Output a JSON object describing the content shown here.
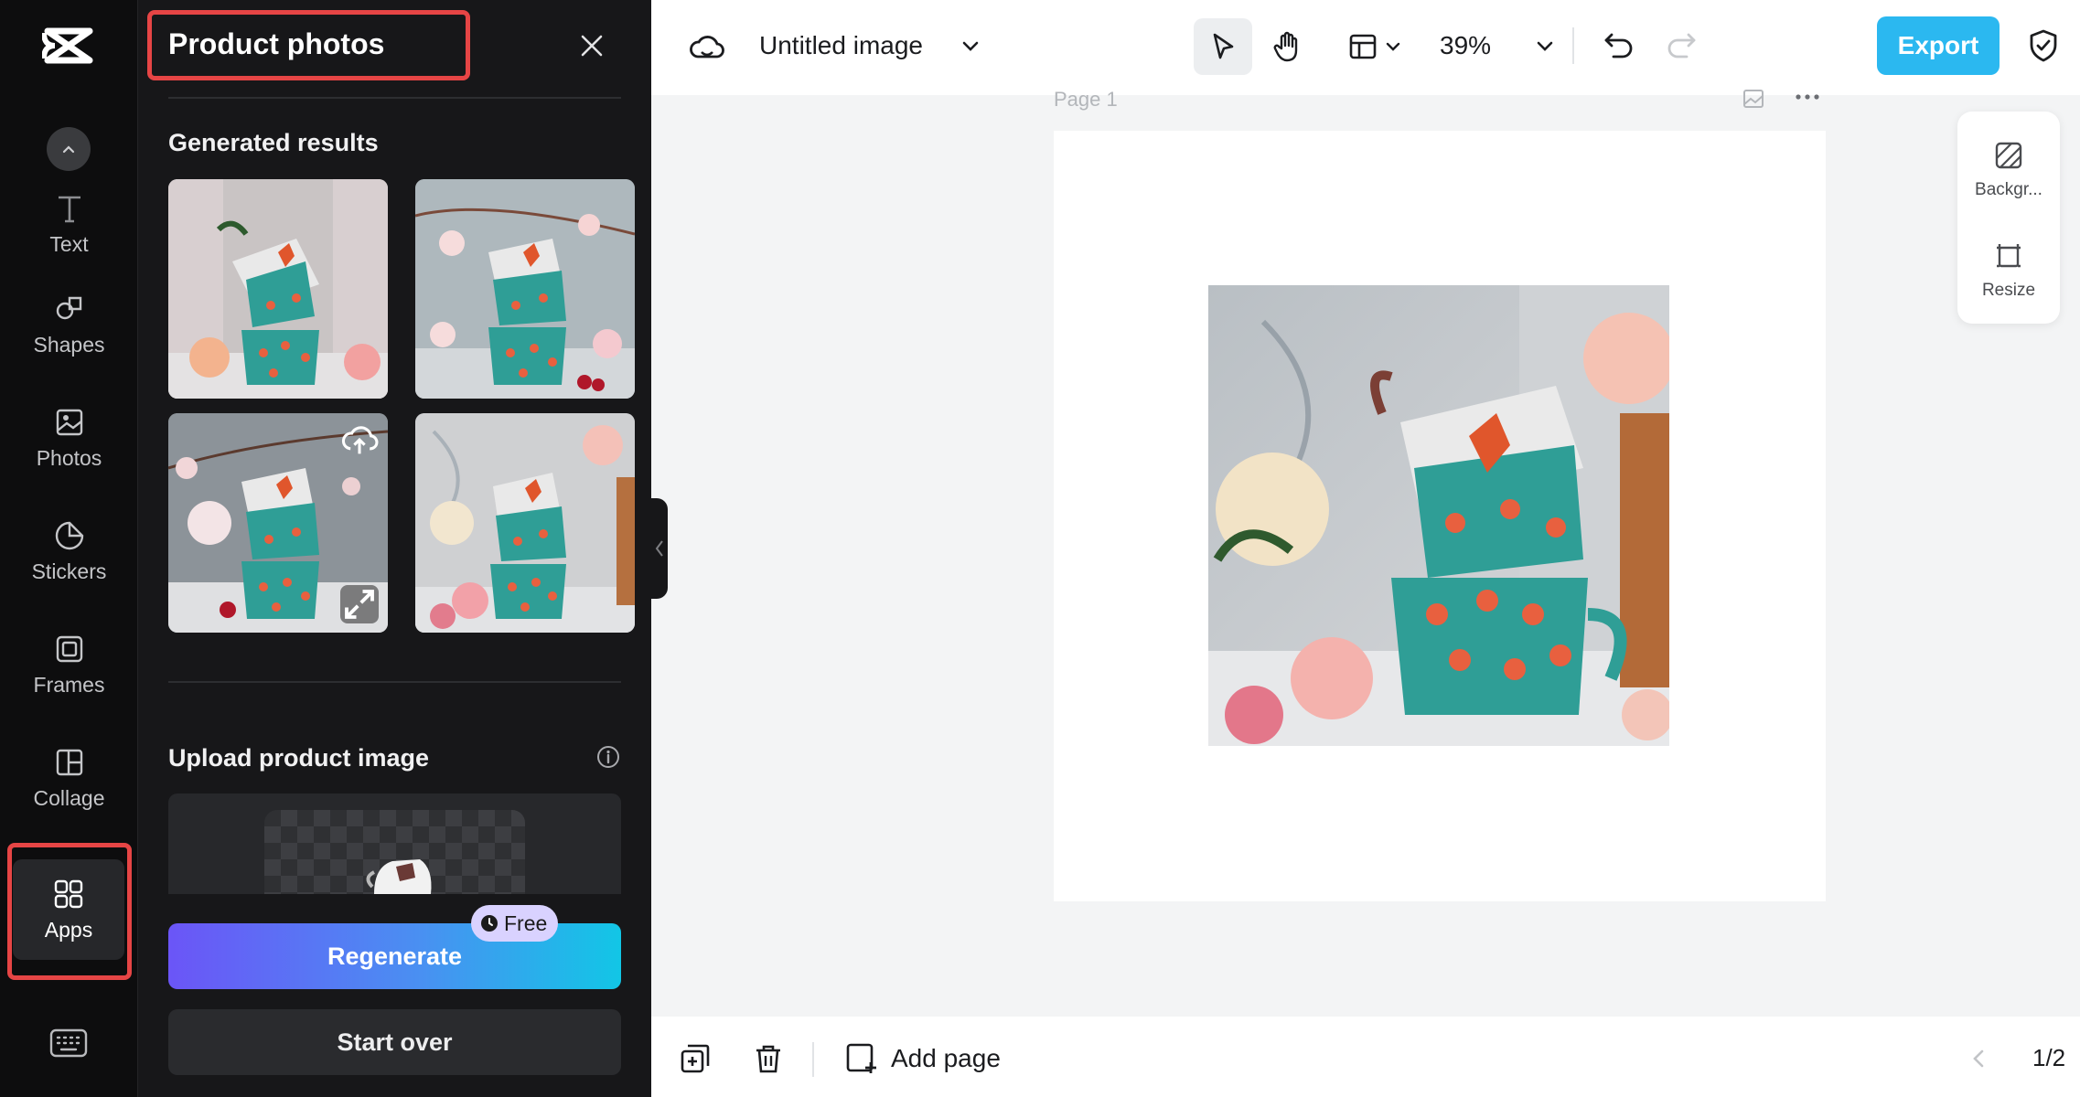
{
  "rail": {
    "items": [
      {
        "label": "Text",
        "icon": "text-icon"
      },
      {
        "label": "Shapes",
        "icon": "shapes-icon"
      },
      {
        "label": "Photos",
        "icon": "photos-icon"
      },
      {
        "label": "Stickers",
        "icon": "stickers-icon"
      },
      {
        "label": "Frames",
        "icon": "frames-icon"
      },
      {
        "label": "Collage",
        "icon": "collage-icon"
      },
      {
        "label": "Apps",
        "icon": "apps-icon"
      }
    ]
  },
  "panel": {
    "title": "Product photos",
    "generated_heading": "Generated results",
    "upload_heading": "Upload product image",
    "regenerate_label": "Regenerate",
    "free_badge": "Free",
    "start_over_label": "Start over"
  },
  "toolbar": {
    "doc_title": "Untitled image",
    "zoom": "39%",
    "export_label": "Export"
  },
  "canvas": {
    "page_label": "Page 1"
  },
  "right_tools": {
    "background_label": "Backgr...",
    "resize_label": "Resize"
  },
  "bottom": {
    "add_page_label": "Add page",
    "page_counter": "1/2"
  },
  "colors": {
    "accent": "#2bb8f0",
    "highlight": "#e64545",
    "mug": "#2f9e96",
    "dot": "#e8603f"
  }
}
